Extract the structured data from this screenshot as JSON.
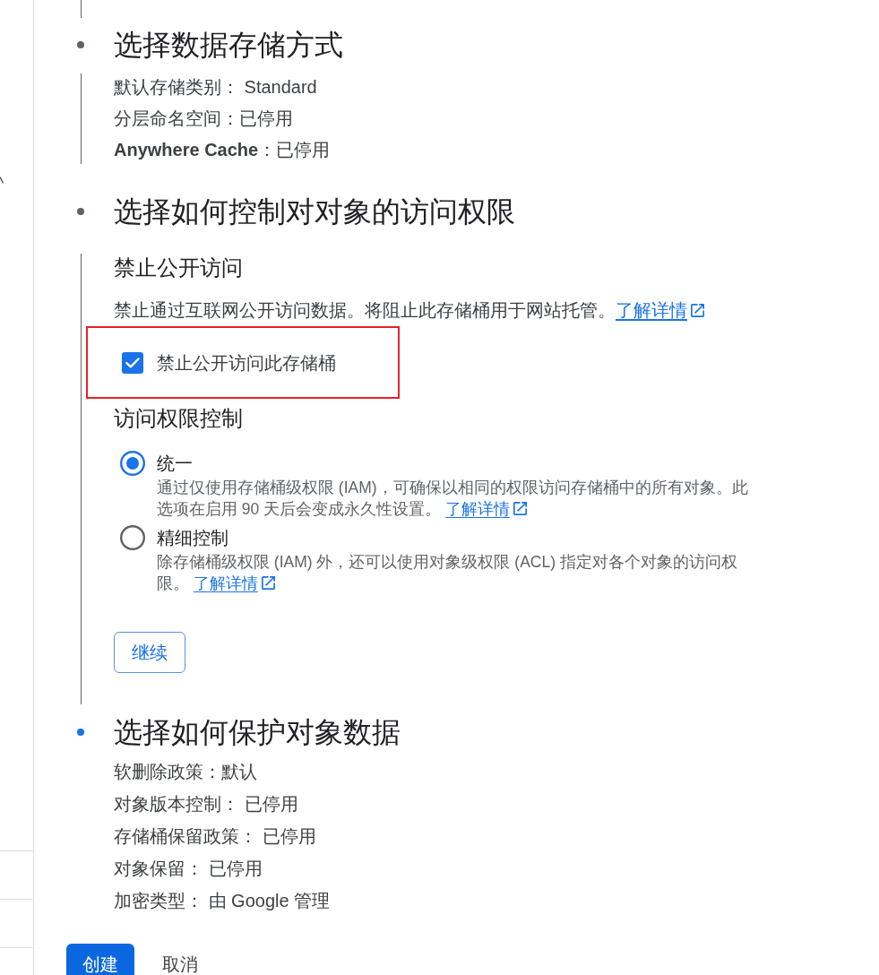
{
  "steps": [
    {
      "kind": "summary",
      "active": false,
      "title": "选择数据存储方式",
      "summary": [
        "默认存储类别： Standard",
        "分层命名空间：已停用",
        "**Anywhere Cache**：已停用"
      ]
    },
    {
      "kind": "form",
      "active": false,
      "title": "选择如何控制对对象的访问权限",
      "public_access": {
        "heading": "禁止公开访问",
        "description": "禁止通过互联网公开访问数据。将阻止此存储桶用于网站托管。",
        "link": "了解详情",
        "checkbox": {
          "label": "禁止公开访问此存储桶",
          "checked": true,
          "highlighted": true
        }
      },
      "access_control": {
        "heading": "访问权限控制",
        "options": [
          {
            "label": "统一",
            "selected": true,
            "description": "通过仅使用存储桶级权限 (IAM)，可确保以相同的权限访问存储桶中的所有对象。此选项在启用 90 天后会变成永久性设置。",
            "link": "了解详情"
          },
          {
            "label": "精细控制",
            "selected": false,
            "description": "除存储桶级权限 (IAM) 外，还可以使用对象级权限 (ACL) 指定对各个对象的访问权限。",
            "link": "了解详情"
          }
        ]
      },
      "continue_button": "继续"
    },
    {
      "kind": "summary",
      "active": true,
      "title": "选择如何保护对象数据",
      "summary": [
        "软删除政策：默认",
        "对象版本控制： 已停用",
        "存储桶保留政策： 已停用",
        "对象保留： 已停用",
        "加密类型： 由 Google 管理"
      ]
    }
  ],
  "actions": [
    {
      "kind": "primary",
      "label": "创建"
    },
    {
      "kind": "text",
      "label": "取消"
    }
  ]
}
